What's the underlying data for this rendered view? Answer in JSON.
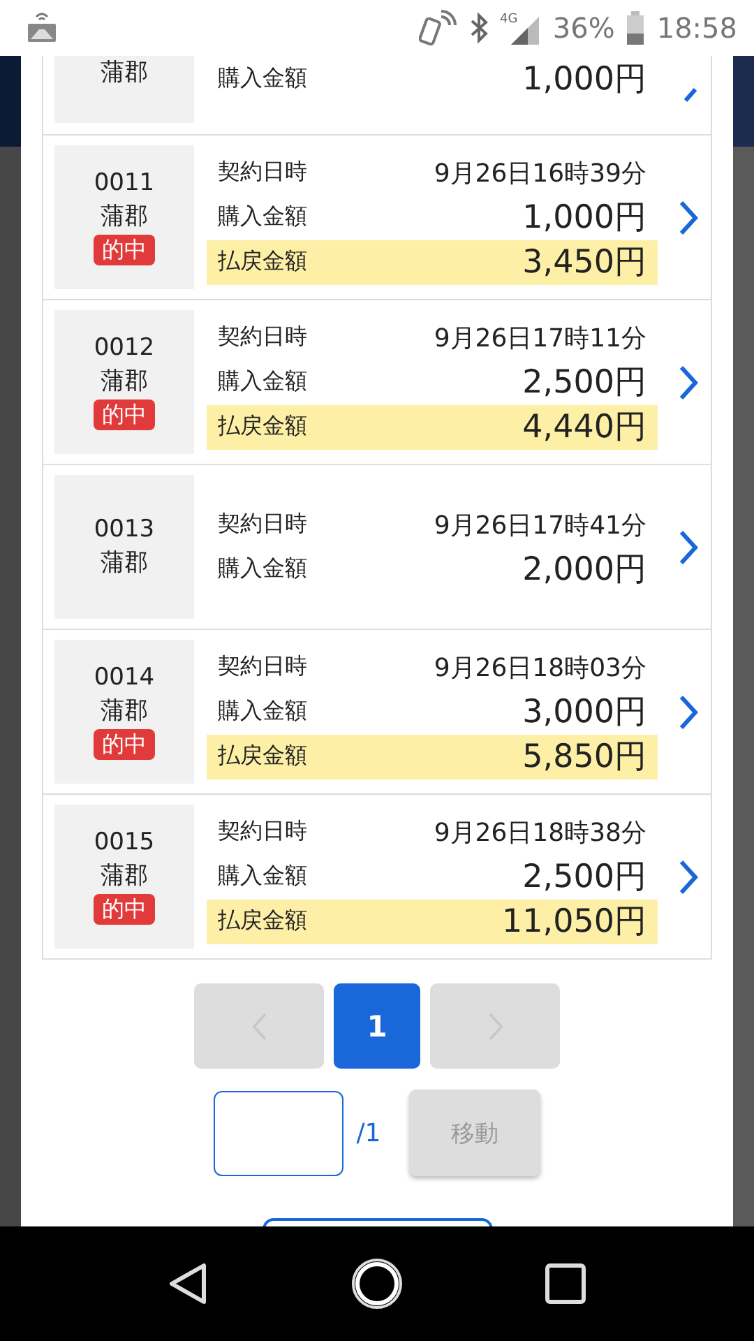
{
  "status_bar": {
    "network": "4G",
    "battery": "36%",
    "time": "18:58"
  },
  "records": [
    {
      "kind": "partial",
      "venue": "蒲郡",
      "purchase_label": "購入金額",
      "purchase": "1,000円"
    },
    {
      "kind": "full",
      "number": "0011",
      "venue": "蒲郡",
      "badge": "的中",
      "date_label": "契約日時",
      "date": "9月26日16時39分",
      "purchase_label": "購入金額",
      "purchase": "1,000円",
      "payout_label": "払戻金額",
      "payout": "3,450円"
    },
    {
      "kind": "full",
      "number": "0012",
      "venue": "蒲郡",
      "badge": "的中",
      "date_label": "契約日時",
      "date": "9月26日17時11分",
      "purchase_label": "購入金額",
      "purchase": "2,500円",
      "payout_label": "払戻金額",
      "payout": "4,440円"
    },
    {
      "kind": "full",
      "number": "0013",
      "venue": "蒲郡",
      "date_label": "契約日時",
      "date": "9月26日17時41分",
      "purchase_label": "購入金額",
      "purchase": "2,000円"
    },
    {
      "kind": "full",
      "number": "0014",
      "venue": "蒲郡",
      "badge": "的中",
      "date_label": "契約日時",
      "date": "9月26日18時03分",
      "purchase_label": "購入金額",
      "purchase": "3,000円",
      "payout_label": "払戻金額",
      "payout": "5,850円"
    },
    {
      "kind": "full",
      "number": "0015",
      "venue": "蒲郡",
      "badge": "的中",
      "date_label": "契約日時",
      "date": "9月26日18時38分",
      "purchase_label": "購入金額",
      "purchase": "2,500円",
      "payout_label": "払戻金額",
      "payout": "11,050円"
    }
  ],
  "pagination": {
    "prev_disabled": true,
    "pages": [
      {
        "label": "1",
        "selected": true
      }
    ],
    "next_disabled": true
  },
  "page_jump": {
    "total": "/1",
    "button": "移動",
    "button_disabled": true
  }
}
